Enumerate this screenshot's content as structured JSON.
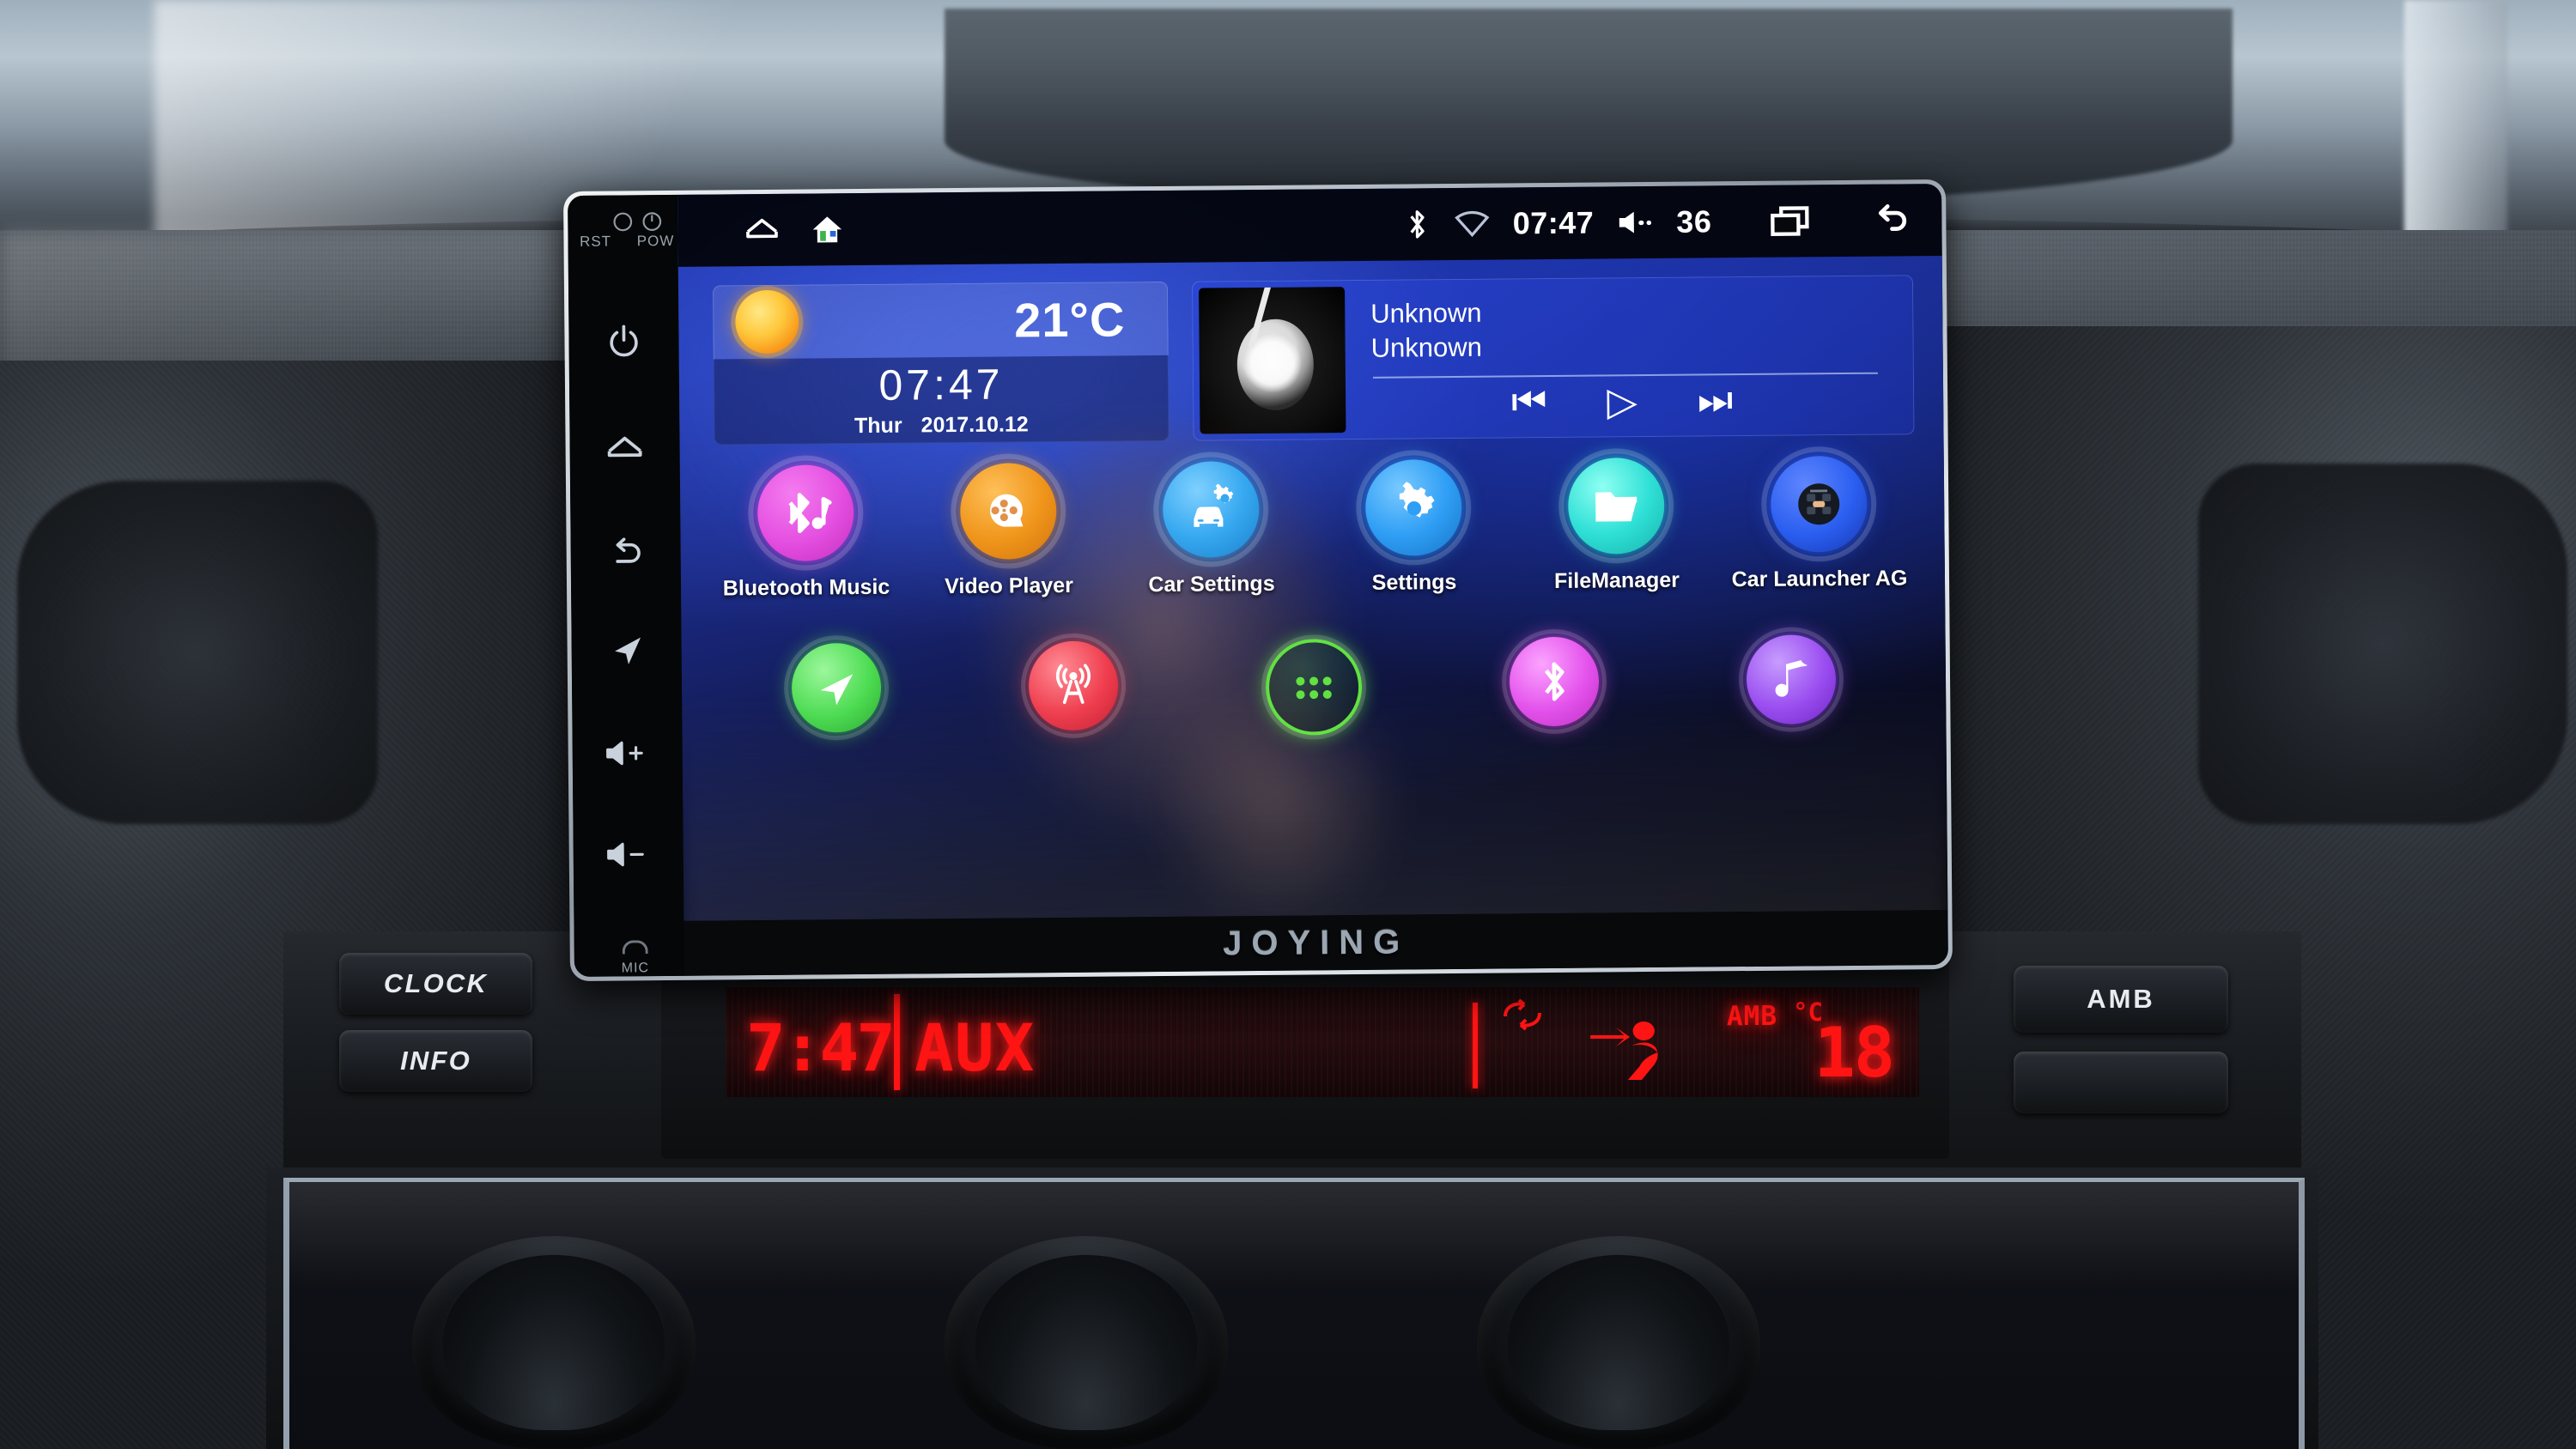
{
  "scene": {
    "description": "Car dashboard with aftermarket Android head unit"
  },
  "head_unit": {
    "brand": "JOYING",
    "bezel": {
      "reset_label": "RST",
      "power_label": "POW",
      "mic_label": "MIC",
      "buttons": [
        {
          "name": "power",
          "icon": "power-icon"
        },
        {
          "name": "home",
          "icon": "home-icon"
        },
        {
          "name": "back",
          "icon": "back-icon"
        },
        {
          "name": "navigation",
          "icon": "navigation-icon"
        },
        {
          "name": "volume-up",
          "icon": "volume-up-icon",
          "label": "+"
        },
        {
          "name": "volume-down",
          "icon": "volume-down-icon",
          "label": "−"
        }
      ]
    },
    "status_bar": {
      "home_outline_icon": "home-outline-icon",
      "home_filled_icon": "home-filled-icon",
      "bluetooth_icon": "bluetooth-icon",
      "wifi_icon": "wifi-icon",
      "clock": "07:47",
      "volume_icon": "volume-icon",
      "volume_level": "36",
      "recents_icon": "recents-icon",
      "back_icon": "back-arrow-icon"
    },
    "weather_widget": {
      "condition_icon": "sunny-icon",
      "temperature": "21°C",
      "time": "07:47",
      "weekday": "Thur",
      "date": "2017.10.12"
    },
    "music_widget": {
      "title": "Unknown",
      "artist": "Unknown",
      "album_art_icon": "album-art",
      "prev_icon": "⏮",
      "play_icon": "▷",
      "next_icon": "⏭"
    },
    "apps": [
      {
        "label": "Bluetooth Music",
        "icon": "bluetooth-music-icon",
        "color": "#e44ee0"
      },
      {
        "label": "Video Player",
        "icon": "film-reel-icon",
        "color": "#f0961c"
      },
      {
        "label": "Car Settings",
        "icon": "car-gear-icon",
        "color": "#36a8f0"
      },
      {
        "label": "Settings",
        "icon": "gear-icon",
        "color": "#2f9ef5"
      },
      {
        "label": "FileManager",
        "icon": "folder-icon",
        "color": "#2fe0d6"
      },
      {
        "label": "Car Launcher AG",
        "icon": "car-launcher-ag-icon",
        "color": "#2a5ef0"
      }
    ],
    "dock": [
      {
        "name": "navigation",
        "icon": "navigation-arrow-icon",
        "color": "#4ddc52"
      },
      {
        "name": "radio",
        "icon": "radio-tower-icon",
        "color": "#ef3d4e"
      },
      {
        "name": "app-drawer",
        "icon": "app-drawer-icon",
        "color": "#61e241"
      },
      {
        "name": "bluetooth",
        "icon": "bluetooth-icon",
        "color": "#e452ec"
      },
      {
        "name": "music",
        "icon": "music-note-icon",
        "color": "#9a4df0"
      }
    ]
  },
  "car_panel": {
    "buttons": [
      {
        "label": "CLOCK",
        "name": "clock-button"
      },
      {
        "label": "INFO",
        "name": "info-button"
      },
      {
        "label": "AMB",
        "name": "amb-button"
      }
    ],
    "vfd_display": {
      "time": "7:47",
      "source": "AUX",
      "recirculation_icon": "recirculation-icon",
      "airflow_icon": "airflow-icon",
      "ambient_label": "AMB",
      "unit_label": "°C",
      "temperature": "18"
    }
  }
}
